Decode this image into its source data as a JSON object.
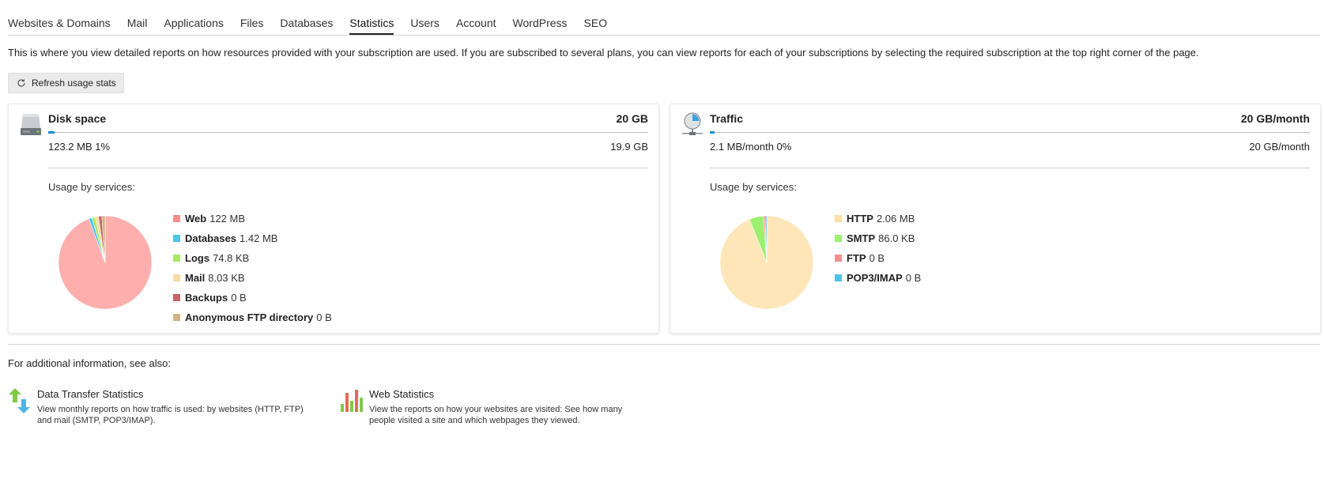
{
  "tabs": [
    {
      "label": "Websites & Domains"
    },
    {
      "label": "Mail"
    },
    {
      "label": "Applications"
    },
    {
      "label": "Files"
    },
    {
      "label": "Databases"
    },
    {
      "label": "Statistics",
      "active": true
    },
    {
      "label": "Users"
    },
    {
      "label": "Account"
    },
    {
      "label": "WordPress"
    },
    {
      "label": "SEO"
    }
  ],
  "intro_text": "This is where you view detailed reports on how resources provided with your subscription are used. If you are subscribed to several plans, you can view reports for each of your subscriptions by selecting the required subscription at the top right corner of the page.",
  "refresh_button": {
    "label": "Refresh usage stats",
    "icon": "refresh-icon"
  },
  "disk": {
    "icon": "hard-drive-icon",
    "title": "Disk space",
    "total": "20 GB",
    "used": "123.2 MB 1%",
    "used_fraction": 0.01,
    "free": "19.9 GB",
    "usage_label": "Usage by services:",
    "legend": [
      {
        "name": "Web",
        "value": "122 MB",
        "color": "#f28f8f"
      },
      {
        "name": "Databases",
        "value": "1.42 MB",
        "color": "#4fc3e8"
      },
      {
        "name": "Logs",
        "value": "74.8 KB",
        "color": "#a8e86a"
      },
      {
        "name": "Mail",
        "value": "8.03 KB",
        "color": "#f7dca0"
      },
      {
        "name": "Backups",
        "value": "0 B",
        "color": "#c86464"
      },
      {
        "name": "Anonymous FTP directory",
        "value": "0 B",
        "color": "#d2b482"
      }
    ]
  },
  "traffic": {
    "icon": "traffic-icon",
    "title": "Traffic",
    "total": "20 GB/month",
    "used": "2.1 MB/month 0%",
    "used_fraction": 0.0,
    "free": "20 GB/month",
    "usage_label": "Usage by services:",
    "legend": [
      {
        "name": "HTTP",
        "value": "2.06 MB",
        "color": "#fde0a8"
      },
      {
        "name": "SMTP",
        "value": "86.0 KB",
        "color": "#9cf06e"
      },
      {
        "name": "FTP",
        "value": "0 B",
        "color": "#f28f8f"
      },
      {
        "name": "POP3/IMAP",
        "value": "0 B",
        "color": "#4fc3e8"
      }
    ]
  },
  "see_also_label": "For additional information, see also:",
  "links": [
    {
      "icon": "data-transfer-icon",
      "title": "Data Transfer Statistics",
      "desc": "View monthly reports on how traffic is used: by websites (HTTP, FTP) and mail (SMTP, POP3/IMAP)."
    },
    {
      "icon": "web-statistics-icon",
      "title": "Web Statistics",
      "desc": "View the reports on how your websites are visited: See how many people visited a site and which webpages they viewed."
    }
  ]
}
